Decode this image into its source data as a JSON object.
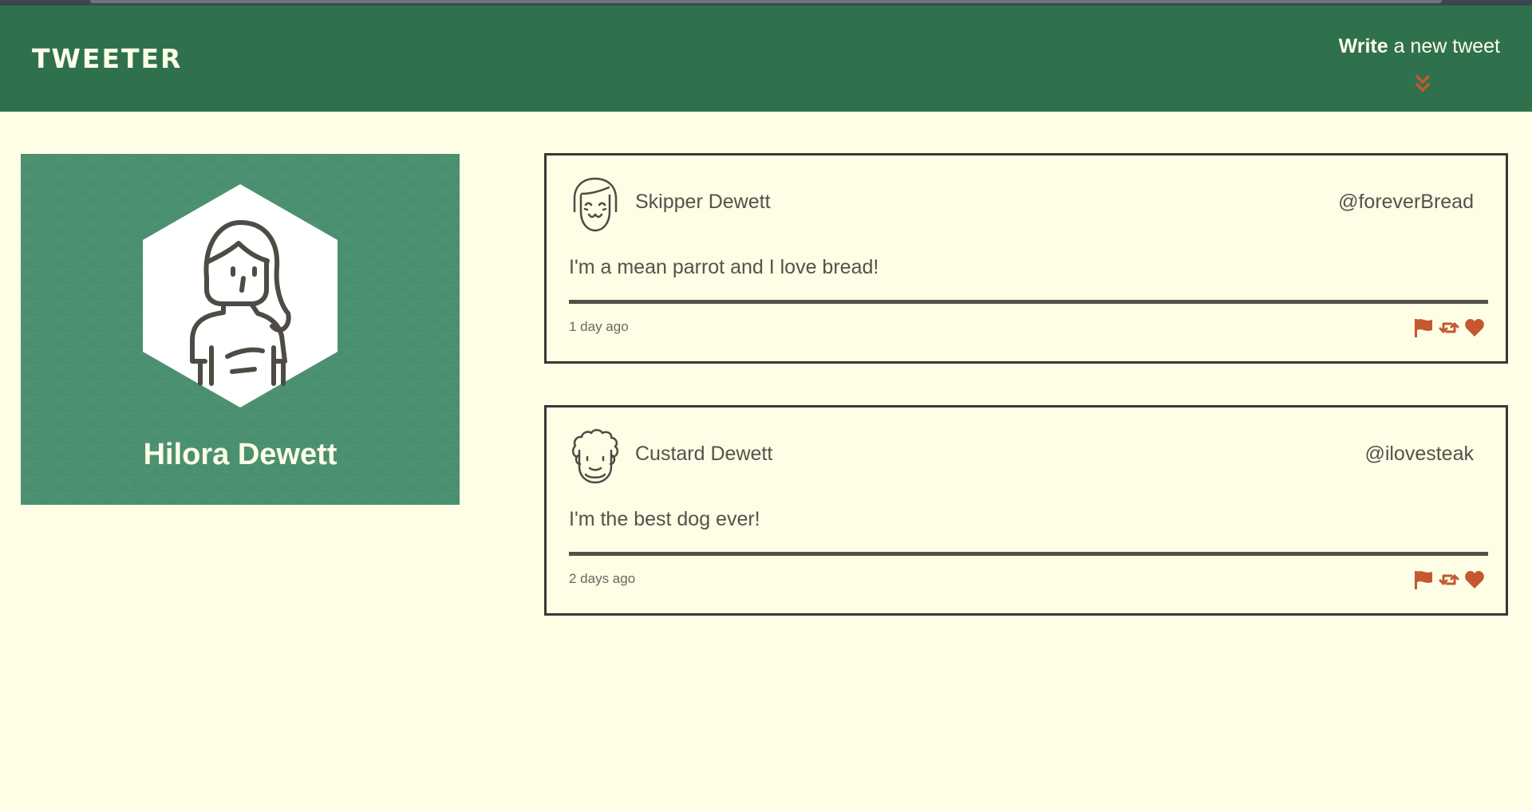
{
  "nav": {
    "brand": "TWEETER",
    "compose_bold": "Write",
    "compose_rest": " a new tweet"
  },
  "profile": {
    "name": "Hilora Dewett"
  },
  "tweets": [
    {
      "author": "Skipper Dewett",
      "handle": "@foreverBread",
      "content": "I'm a mean parrot and I love bread!",
      "timestamp": "1 day ago"
    },
    {
      "author": "Custard Dewett",
      "handle": "@ilovesteak",
      "content": "I'm the best dog ever!",
      "timestamp": "2 days ago"
    }
  ],
  "icons": {
    "flag": "flag-icon",
    "retweet": "retweet-icon",
    "like": "heart-icon",
    "compose": "double-chevron-down-icon"
  },
  "colors": {
    "nav_bg": "#2f714d",
    "page_bg": "#fefde6",
    "profile_bg": "#4a9070",
    "accent": "#c4582e",
    "text": "#545149"
  }
}
